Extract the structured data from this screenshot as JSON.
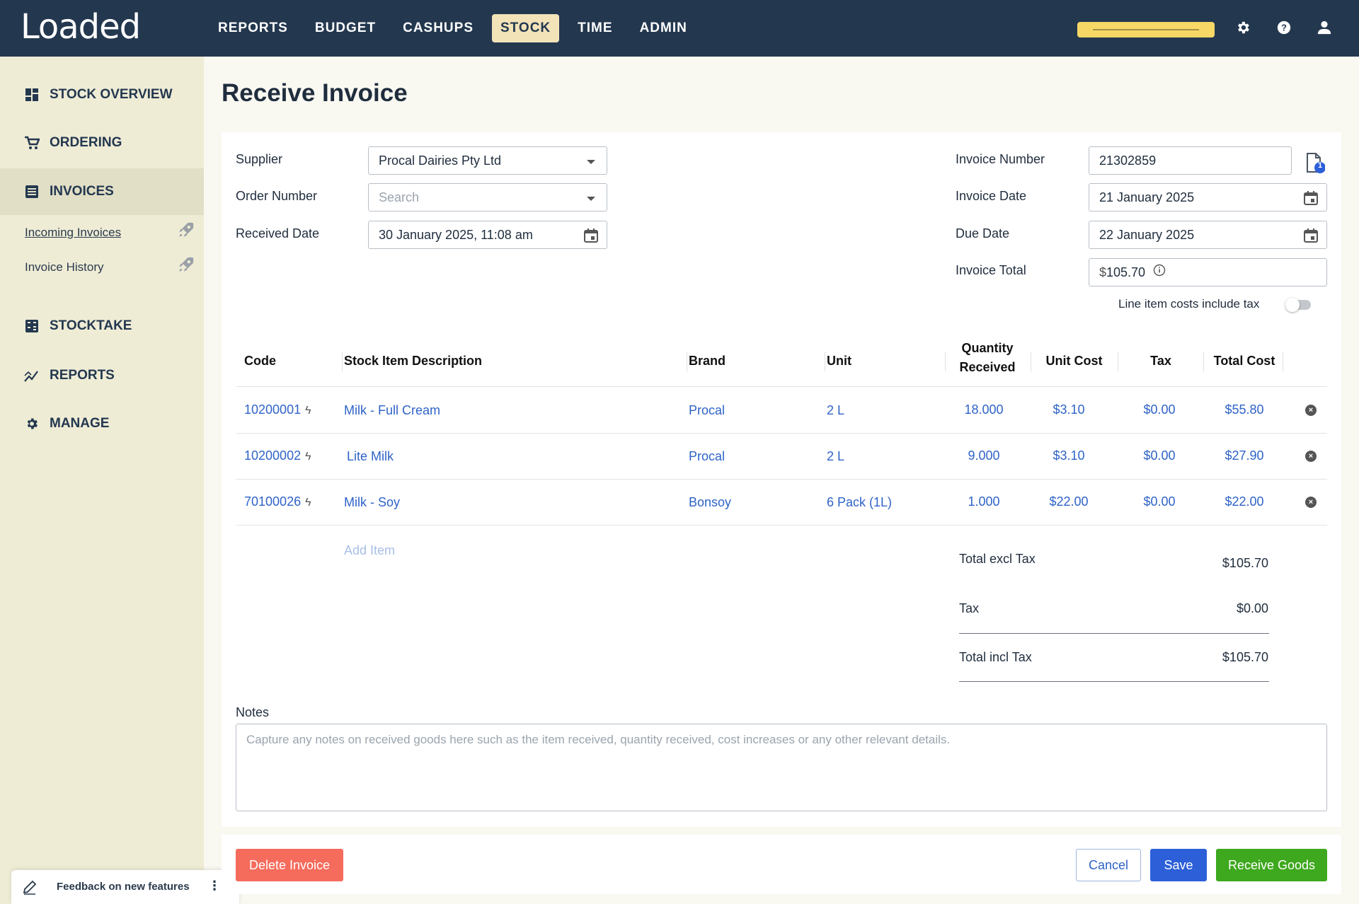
{
  "app": {
    "logo": "Loaded"
  },
  "nav": [
    "REPORTS",
    "BUDGET",
    "CASHUPS",
    "STOCK",
    "TIME",
    "ADMIN"
  ],
  "nav_active": "STOCK",
  "sidebar": {
    "items": [
      {
        "label": "STOCK OVERVIEW",
        "icon": "dashboard-icon"
      },
      {
        "label": "ORDERING",
        "icon": "cart-icon"
      },
      {
        "label": "INVOICES",
        "icon": "list-icon"
      },
      {
        "label": "STOCKTAKE",
        "icon": "calculator-icon"
      },
      {
        "label": "REPORTS",
        "icon": "chart-icon"
      },
      {
        "label": "MANAGE",
        "icon": "gear-icon"
      }
    ],
    "subitems": [
      "Incoming Invoices",
      "Invoice History"
    ]
  },
  "feedback": {
    "label": "Feedback on new features"
  },
  "page": {
    "title": "Receive Invoice"
  },
  "form": {
    "supplier_label": "Supplier",
    "supplier_value": "Procal Dairies Pty Ltd",
    "order_number_label": "Order Number",
    "order_number_placeholder": "Search",
    "received_date_label": "Received Date",
    "received_date_value": "30 January 2025, 11:08 am",
    "invoice_number_label": "Invoice Number",
    "invoice_number_value": "21302859",
    "invoice_date_label": "Invoice Date",
    "invoice_date_value": "21 January 2025",
    "due_date_label": "Due Date",
    "due_date_value": "22 January 2025",
    "invoice_total_label": "Invoice Total",
    "invoice_total_currency": "$",
    "invoice_total_value": "105.70",
    "tax_toggle_label": "Line item costs include tax",
    "attachment_count": "1"
  },
  "table": {
    "headers": {
      "code": "Code",
      "description": "Stock Item Description",
      "brand": "Brand",
      "unit": "Unit",
      "qty_line1": "Quantity",
      "qty_line2": "Received",
      "unit_cost": "Unit Cost",
      "tax": "Tax",
      "total_cost": "Total Cost"
    },
    "rows": [
      {
        "code": "10200001",
        "description": "Milk - Full Cream",
        "brand": "Procal",
        "unit": "2 L",
        "qty": "18.000",
        "unit_cost": "$3.10",
        "tax": "$0.00",
        "total": "$55.80"
      },
      {
        "code": "10200002",
        "description": "Lite Milk",
        "brand": "Procal",
        "unit": "2 L",
        "qty": "9.000",
        "unit_cost": "$3.10",
        "tax": "$0.00",
        "total": "$27.90"
      },
      {
        "code": "70100026",
        "description": "Milk - Soy",
        "brand": "Bonsoy",
        "unit": "6 Pack (1L)",
        "qty": "1.000",
        "unit_cost": "$22.00",
        "tax": "$0.00",
        "total": "$22.00"
      }
    ],
    "add_item_label": "Add Item"
  },
  "totals": {
    "excl_label": "Total excl Tax",
    "excl_value": "$105.70",
    "tax_label": "Tax",
    "tax_value": "$0.00",
    "incl_label": "Total incl Tax",
    "incl_value": "$105.70"
  },
  "notes": {
    "label": "Notes",
    "placeholder": "Capture any notes on received goods here such as the item received, quantity received, cost increases or any other relevant details."
  },
  "buttons": {
    "delete": "Delete Invoice",
    "cancel": "Cancel",
    "save": "Save",
    "receive": "Receive Goods"
  }
}
